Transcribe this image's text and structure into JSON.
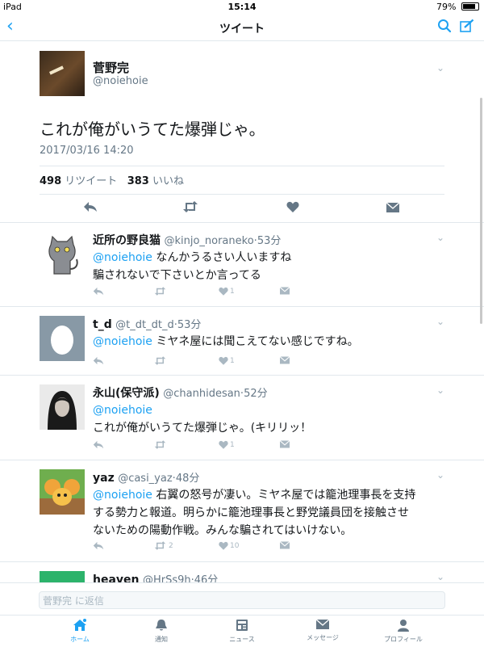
{
  "status_bar": {
    "device": "iPad",
    "time": "15:14",
    "battery": "79%"
  },
  "nav": {
    "title": "ツイート"
  },
  "tweet": {
    "name": "菅野完",
    "handle": "@noiehoie",
    "text": "これが俺がいうてた爆弾じゃ。",
    "date": "2017/03/16 14:20",
    "retweets": "498",
    "retweets_label": "リツイート",
    "likes": "383",
    "likes_label": "いいね"
  },
  "replies": [
    {
      "name": "近所の野良猫",
      "handle": "@kinjo_noraneko",
      "time": "53分",
      "mention": "@noiehoie",
      "line1": " なんかうるさい人いますね",
      "line2": "騙されないで下さいとか言ってる",
      "line3": "",
      "rt": "",
      "like": "1"
    },
    {
      "name": "t_d",
      "handle": "@t_dt_dt_d",
      "time": "53分",
      "mention": "@noiehoie",
      "line1": " ミヤネ屋には聞こえてない感じですね。",
      "line2": "",
      "line3": "",
      "rt": "",
      "like": "1"
    },
    {
      "name": "永山(保守派)",
      "handle": "@chanhidesan",
      "time": "52分",
      "mention": "@noiehoie",
      "line1": "",
      "line2": "これが俺がいうてた爆弾じゃ。(キリリッ！",
      "line3": "",
      "rt": "",
      "like": "1"
    },
    {
      "name": "yaz",
      "handle": "@casi_yaz",
      "time": "48分",
      "mention": "@noiehoie",
      "line1": " 右翼の怒号が凄い。ミヤネ屋では籠池理事長を支持",
      "line2": "する勢力と報道。明らかに籠池理事長と野党議員団を接触させ",
      "line3": "ないための陽動作戦。みんな騙されてはいけない。",
      "rt": "2",
      "like": "10"
    },
    {
      "name": "heaven",
      "handle": "@HrSs9h",
      "time": "46分",
      "mention": "",
      "line1": "",
      "line2": "",
      "line3": "",
      "rt": "",
      "like": ""
    }
  ],
  "reply_bar": {
    "placeholder": "菅野完 に返信"
  },
  "tabs": [
    {
      "label": "ホーム"
    },
    {
      "label": "通知"
    },
    {
      "label": "ニュース"
    },
    {
      "label": "メッセージ"
    },
    {
      "label": "プロフィール"
    }
  ],
  "colors": {
    "accent": "#1da1f2",
    "muted": "#657786",
    "border": "#e1e8ed"
  }
}
